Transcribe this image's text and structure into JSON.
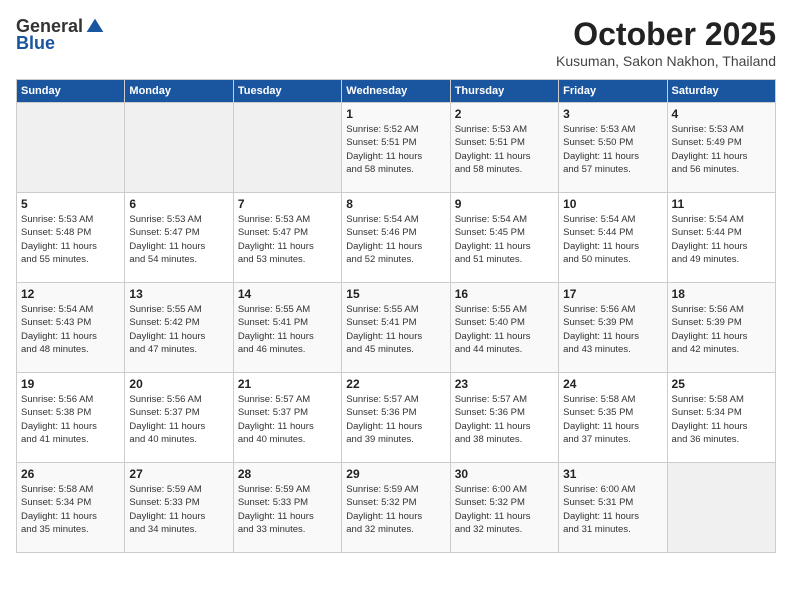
{
  "logo": {
    "general": "General",
    "blue": "Blue"
  },
  "title": "October 2025",
  "subtitle": "Kusuman, Sakon Nakhon, Thailand",
  "headers": [
    "Sunday",
    "Monday",
    "Tuesday",
    "Wednesday",
    "Thursday",
    "Friday",
    "Saturday"
  ],
  "weeks": [
    [
      {
        "day": "",
        "info": ""
      },
      {
        "day": "",
        "info": ""
      },
      {
        "day": "",
        "info": ""
      },
      {
        "day": "1",
        "info": "Sunrise: 5:52 AM\nSunset: 5:51 PM\nDaylight: 11 hours\nand 58 minutes."
      },
      {
        "day": "2",
        "info": "Sunrise: 5:53 AM\nSunset: 5:51 PM\nDaylight: 11 hours\nand 58 minutes."
      },
      {
        "day": "3",
        "info": "Sunrise: 5:53 AM\nSunset: 5:50 PM\nDaylight: 11 hours\nand 57 minutes."
      },
      {
        "day": "4",
        "info": "Sunrise: 5:53 AM\nSunset: 5:49 PM\nDaylight: 11 hours\nand 56 minutes."
      }
    ],
    [
      {
        "day": "5",
        "info": "Sunrise: 5:53 AM\nSunset: 5:48 PM\nDaylight: 11 hours\nand 55 minutes."
      },
      {
        "day": "6",
        "info": "Sunrise: 5:53 AM\nSunset: 5:47 PM\nDaylight: 11 hours\nand 54 minutes."
      },
      {
        "day": "7",
        "info": "Sunrise: 5:53 AM\nSunset: 5:47 PM\nDaylight: 11 hours\nand 53 minutes."
      },
      {
        "day": "8",
        "info": "Sunrise: 5:54 AM\nSunset: 5:46 PM\nDaylight: 11 hours\nand 52 minutes."
      },
      {
        "day": "9",
        "info": "Sunrise: 5:54 AM\nSunset: 5:45 PM\nDaylight: 11 hours\nand 51 minutes."
      },
      {
        "day": "10",
        "info": "Sunrise: 5:54 AM\nSunset: 5:44 PM\nDaylight: 11 hours\nand 50 minutes."
      },
      {
        "day": "11",
        "info": "Sunrise: 5:54 AM\nSunset: 5:44 PM\nDaylight: 11 hours\nand 49 minutes."
      }
    ],
    [
      {
        "day": "12",
        "info": "Sunrise: 5:54 AM\nSunset: 5:43 PM\nDaylight: 11 hours\nand 48 minutes."
      },
      {
        "day": "13",
        "info": "Sunrise: 5:55 AM\nSunset: 5:42 PM\nDaylight: 11 hours\nand 47 minutes."
      },
      {
        "day": "14",
        "info": "Sunrise: 5:55 AM\nSunset: 5:41 PM\nDaylight: 11 hours\nand 46 minutes."
      },
      {
        "day": "15",
        "info": "Sunrise: 5:55 AM\nSunset: 5:41 PM\nDaylight: 11 hours\nand 45 minutes."
      },
      {
        "day": "16",
        "info": "Sunrise: 5:55 AM\nSunset: 5:40 PM\nDaylight: 11 hours\nand 44 minutes."
      },
      {
        "day": "17",
        "info": "Sunrise: 5:56 AM\nSunset: 5:39 PM\nDaylight: 11 hours\nand 43 minutes."
      },
      {
        "day": "18",
        "info": "Sunrise: 5:56 AM\nSunset: 5:39 PM\nDaylight: 11 hours\nand 42 minutes."
      }
    ],
    [
      {
        "day": "19",
        "info": "Sunrise: 5:56 AM\nSunset: 5:38 PM\nDaylight: 11 hours\nand 41 minutes."
      },
      {
        "day": "20",
        "info": "Sunrise: 5:56 AM\nSunset: 5:37 PM\nDaylight: 11 hours\nand 40 minutes."
      },
      {
        "day": "21",
        "info": "Sunrise: 5:57 AM\nSunset: 5:37 PM\nDaylight: 11 hours\nand 40 minutes."
      },
      {
        "day": "22",
        "info": "Sunrise: 5:57 AM\nSunset: 5:36 PM\nDaylight: 11 hours\nand 39 minutes."
      },
      {
        "day": "23",
        "info": "Sunrise: 5:57 AM\nSunset: 5:36 PM\nDaylight: 11 hours\nand 38 minutes."
      },
      {
        "day": "24",
        "info": "Sunrise: 5:58 AM\nSunset: 5:35 PM\nDaylight: 11 hours\nand 37 minutes."
      },
      {
        "day": "25",
        "info": "Sunrise: 5:58 AM\nSunset: 5:34 PM\nDaylight: 11 hours\nand 36 minutes."
      }
    ],
    [
      {
        "day": "26",
        "info": "Sunrise: 5:58 AM\nSunset: 5:34 PM\nDaylight: 11 hours\nand 35 minutes."
      },
      {
        "day": "27",
        "info": "Sunrise: 5:59 AM\nSunset: 5:33 PM\nDaylight: 11 hours\nand 34 minutes."
      },
      {
        "day": "28",
        "info": "Sunrise: 5:59 AM\nSunset: 5:33 PM\nDaylight: 11 hours\nand 33 minutes."
      },
      {
        "day": "29",
        "info": "Sunrise: 5:59 AM\nSunset: 5:32 PM\nDaylight: 11 hours\nand 32 minutes."
      },
      {
        "day": "30",
        "info": "Sunrise: 6:00 AM\nSunset: 5:32 PM\nDaylight: 11 hours\nand 32 minutes."
      },
      {
        "day": "31",
        "info": "Sunrise: 6:00 AM\nSunset: 5:31 PM\nDaylight: 11 hours\nand 31 minutes."
      },
      {
        "day": "",
        "info": ""
      }
    ]
  ]
}
